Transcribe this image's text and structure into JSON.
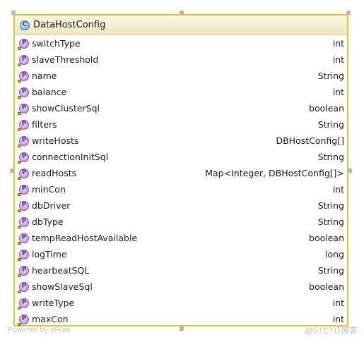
{
  "class": {
    "icon_letter": "C",
    "name": "DataHostConfig"
  },
  "property_icon_letter": "P",
  "fields": [
    {
      "name": "switchType",
      "type": "int"
    },
    {
      "name": "slaveThreshold",
      "type": "int"
    },
    {
      "name": "name",
      "type": "String"
    },
    {
      "name": "balance",
      "type": "int"
    },
    {
      "name": "showClusterSql",
      "type": "boolean"
    },
    {
      "name": "filters",
      "type": "String"
    },
    {
      "name": "writeHosts",
      "type": "DBHostConfig[]"
    },
    {
      "name": "connectionInitSql",
      "type": "String"
    },
    {
      "name": "readHosts",
      "type": "Map<Integer, DBHostConfig[]>"
    },
    {
      "name": "minCon",
      "type": "int"
    },
    {
      "name": "dbDriver",
      "type": "String"
    },
    {
      "name": "dbType",
      "type": "String"
    },
    {
      "name": "tempReadHostAvailable",
      "type": "boolean"
    },
    {
      "name": "logTime",
      "type": "long"
    },
    {
      "name": "hearbeatSQL",
      "type": "String"
    },
    {
      "name": "showSlaveSql",
      "type": "boolean"
    },
    {
      "name": "writeType",
      "type": "int"
    },
    {
      "name": "maxCon",
      "type": "int"
    }
  ],
  "watermarks": {
    "left": "Powered by yFiles",
    "right": "@51CTO博客"
  },
  "colors": {
    "border": "#f0c419",
    "header_bg": "#ece6bf",
    "class_icon": "#7fb2e5",
    "property_icon": "#c89ae6"
  }
}
